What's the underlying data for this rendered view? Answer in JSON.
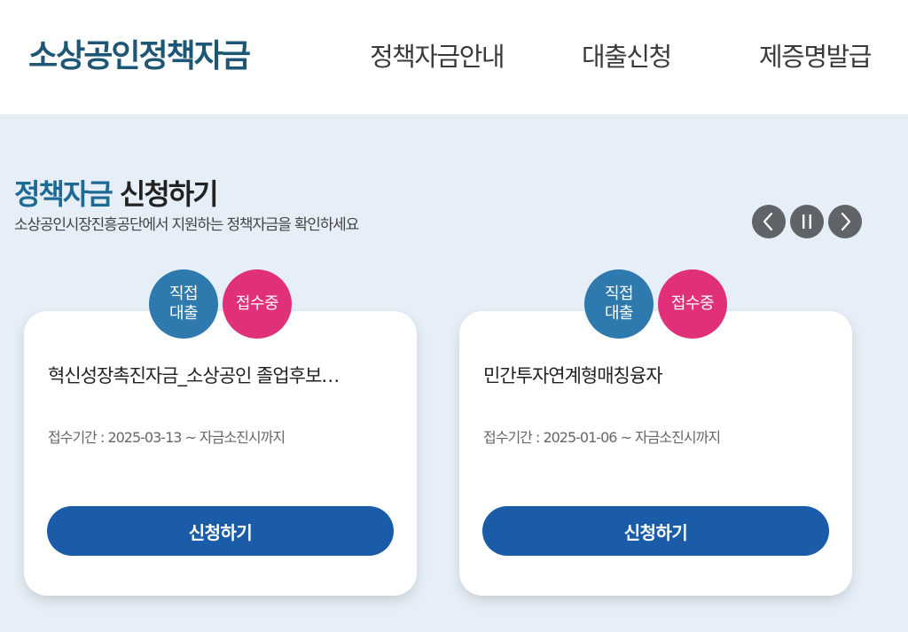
{
  "header": {
    "logo": "소상공인정책자금",
    "nav": [
      "정책자금안내",
      "대출신청",
      "제증명발급"
    ]
  },
  "section": {
    "title_accent": "정책자금",
    "title_rest": "신청하기",
    "subtitle": "소상공인시장진흥공단에서 지원하는 정책자금을 확인하세요",
    "controls": [
      "chevron-left-icon",
      "pause-icon",
      "chevron-right-icon"
    ]
  },
  "cards": [
    {
      "type_line1": "직접",
      "type_line2": "대출",
      "status": "접수중",
      "title": "혁신성장촉진자금_소상공인 졸업후보…",
      "period": "접수기간 : 2025-03-13 ~ 자금소진시까지",
      "button": "신청하기"
    },
    {
      "type_line1": "직접",
      "type_line2": "대출",
      "status": "접수중",
      "title": "민간투자연계형매칭융자",
      "period": "접수기간 : 2025-01-06 ~ 자금소진시까지",
      "button": "신청하기"
    }
  ],
  "colors": {
    "brand": "#1d5775",
    "accent": "#1d6a94",
    "button": "#1a5ca8",
    "badge_type": "#2e79ad",
    "badge_status": "#e0307a",
    "background": "#e6eff7"
  }
}
